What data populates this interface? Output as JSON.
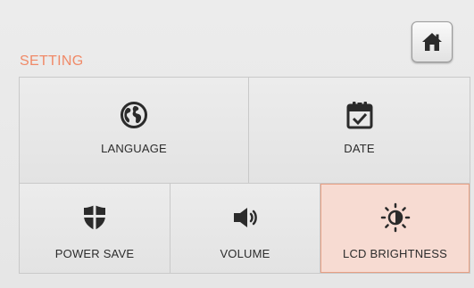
{
  "header": {
    "title": "SETTING",
    "home_icon": "home-icon"
  },
  "tiles": [
    {
      "label": "LANGUAGE",
      "icon": "globe-icon"
    },
    {
      "label": "DATE",
      "icon": "calendar-check-icon"
    },
    {
      "label": "POWER SAVE",
      "icon": "shield-icon"
    },
    {
      "label": "VOLUME",
      "icon": "speaker-icon"
    },
    {
      "label": "LCD BRIGHTNESS",
      "icon": "brightness-icon",
      "selected": true
    }
  ],
  "colors": {
    "title": "#f08a68",
    "selected_bg": "#f7dbd2",
    "selected_border": "#e7a084",
    "icon": "#2b2b2b"
  }
}
